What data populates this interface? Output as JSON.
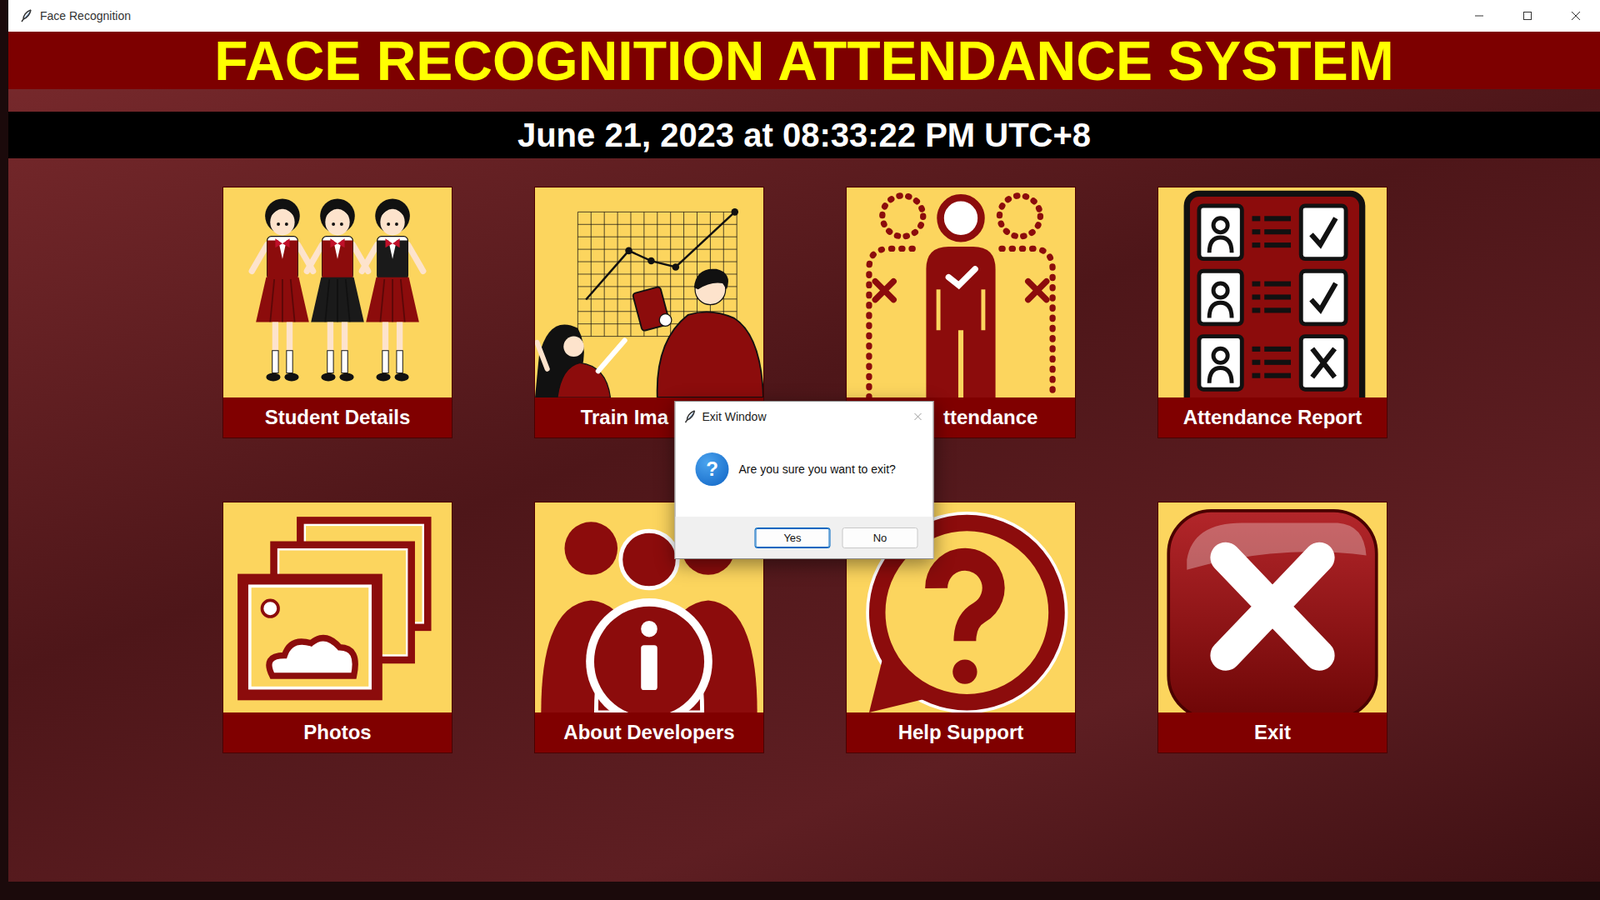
{
  "window": {
    "title": "Face Recognition"
  },
  "header": {
    "title": "FACE RECOGNITION ATTENDANCE SYSTEM"
  },
  "clock": {
    "text": "June 21, 2023 at 08:33:22 PM UTC+8"
  },
  "tiles": [
    {
      "label": "Student Details",
      "kind": "students"
    },
    {
      "label": "Train Ima",
      "kind": "training"
    },
    {
      "label": "ttendance",
      "kind": "attendance"
    },
    {
      "label": "Attendance Report",
      "kind": "report"
    },
    {
      "label": "Photos",
      "kind": "photos"
    },
    {
      "label": "About Developers",
      "kind": "developers"
    },
    {
      "label": "Help Support",
      "kind": "help"
    },
    {
      "label": "Exit",
      "kind": "exit"
    }
  ],
  "dialog": {
    "title": "Exit Window",
    "icon": "?",
    "message": "Are you sure you want to exit?",
    "buttons": [
      {
        "label": "Yes",
        "selected": true
      },
      {
        "label": "No",
        "selected": false
      }
    ]
  }
}
